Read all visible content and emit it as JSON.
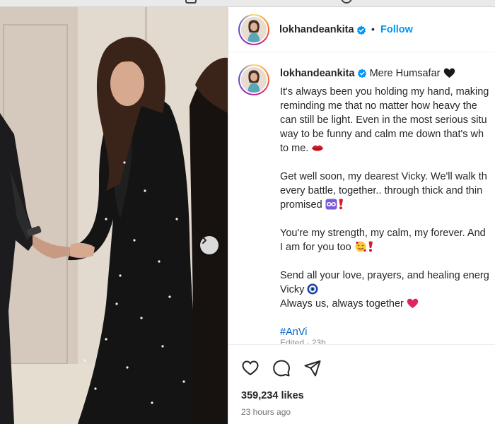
{
  "post": {
    "username": "lokhandeankita",
    "follow_label": "Follow",
    "separator": "•",
    "caption_title": "Mere Humsafar",
    "caption_lines": [
      "It's always been you holding my hand, making",
      "reminding me that no matter how heavy the",
      "can still be light. Even in the most serious situ",
      "way to be funny and calm me down that's wh",
      "to me.",
      "Get well soon, my dearest Vicky. We'll walk th",
      "every battle, together.. through thick and thin",
      "promised",
      "You're my strength, my calm, my forever. And",
      "I am for you too",
      "Send all your love, prayers, and healing energ",
      "Vicky",
      "Always us, always together"
    ],
    "hashtag": "#AnVi",
    "edited": "Edited · 23h",
    "likes": "359,234 likes",
    "time_ago": "23 hours ago"
  },
  "icons": {
    "header": [
      "grid-icon",
      "circle-icon"
    ],
    "carousel": "chevron-right-icon",
    "actions": [
      "heart-icon",
      "comment-icon",
      "share-icon"
    ],
    "verified": "verified-badge-icon",
    "emojis": [
      "black-heart",
      "kiss-lips",
      "infinity",
      "red-exclamation",
      "smiling-hearts",
      "nazar-amulet",
      "red-heart"
    ]
  },
  "colors": {
    "follow": "#0095f6",
    "verified": "#0095f6",
    "hashtag": "#0064c8",
    "muted": "#737373"
  }
}
